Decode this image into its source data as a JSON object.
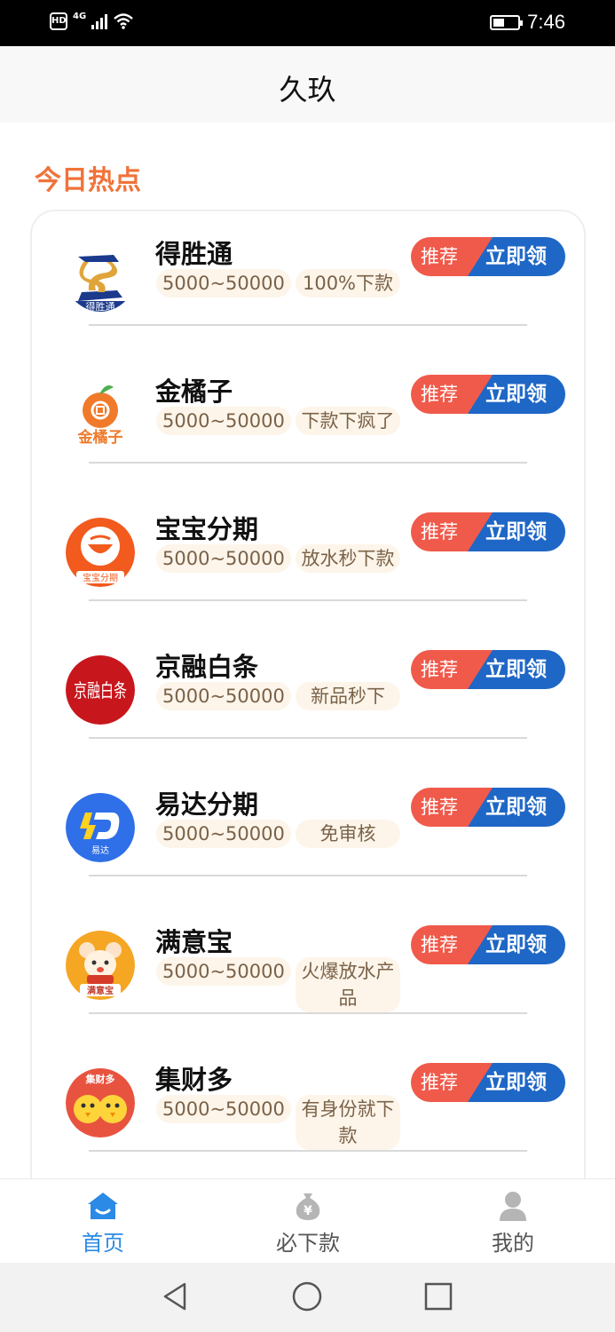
{
  "status_bar": {
    "hd": "HD",
    "network": "4G",
    "time": "7:46"
  },
  "header": {
    "title": "久玖"
  },
  "section": {
    "title": "今日热点"
  },
  "products": [
    {
      "name": "得胜通",
      "amount": "5000~50000",
      "tag": "100%下款",
      "badge": "推荐",
      "action": "立即领",
      "logo": "desheng-logo"
    },
    {
      "name": "金橘子",
      "amount": "5000~50000",
      "tag": "下款下疯了",
      "badge": "推荐",
      "action": "立即领",
      "logo": "orange-logo"
    },
    {
      "name": "宝宝分期",
      "amount": "5000~50000",
      "tag": "放水秒下款",
      "badge": "推荐",
      "action": "立即领",
      "logo": "baobao-logo",
      "logo_text": "宝宝分期"
    },
    {
      "name": "京融白条",
      "amount": "5000~50000",
      "tag": "新品秒下",
      "badge": "推荐",
      "action": "立即领",
      "logo": "jingrong-logo",
      "logo_text": "京融白条"
    },
    {
      "name": "易达分期",
      "amount": "5000~50000",
      "tag": "免审核",
      "badge": "推荐",
      "action": "立即领",
      "logo": "yida-logo",
      "logo_text": "易达"
    },
    {
      "name": "满意宝",
      "amount": "5000~50000",
      "tag": "火爆放水产品",
      "badge": "推荐",
      "action": "立即领",
      "logo": "manyibao-logo",
      "logo_text": "满意宝"
    },
    {
      "name": "集财多",
      "amount": "5000~50000",
      "tag": "有身份就下款",
      "badge": "推荐",
      "action": "立即领",
      "logo": "jicaiduo-logo",
      "logo_text": "集财多"
    }
  ],
  "logo_texts": {
    "desheng": "得胜通",
    "orange": "金橘子"
  },
  "bottom_nav": [
    {
      "label": "首页",
      "icon": "home-icon",
      "active": true
    },
    {
      "label": "必下款",
      "icon": "money-bag-icon",
      "active": false
    },
    {
      "label": "我的",
      "icon": "user-icon",
      "active": false
    }
  ],
  "colors": {
    "accent_orange": "#f0733a",
    "recommend_red": "#f05a4b",
    "action_blue": "#1f67c6",
    "nav_active": "#2b8ae6"
  }
}
